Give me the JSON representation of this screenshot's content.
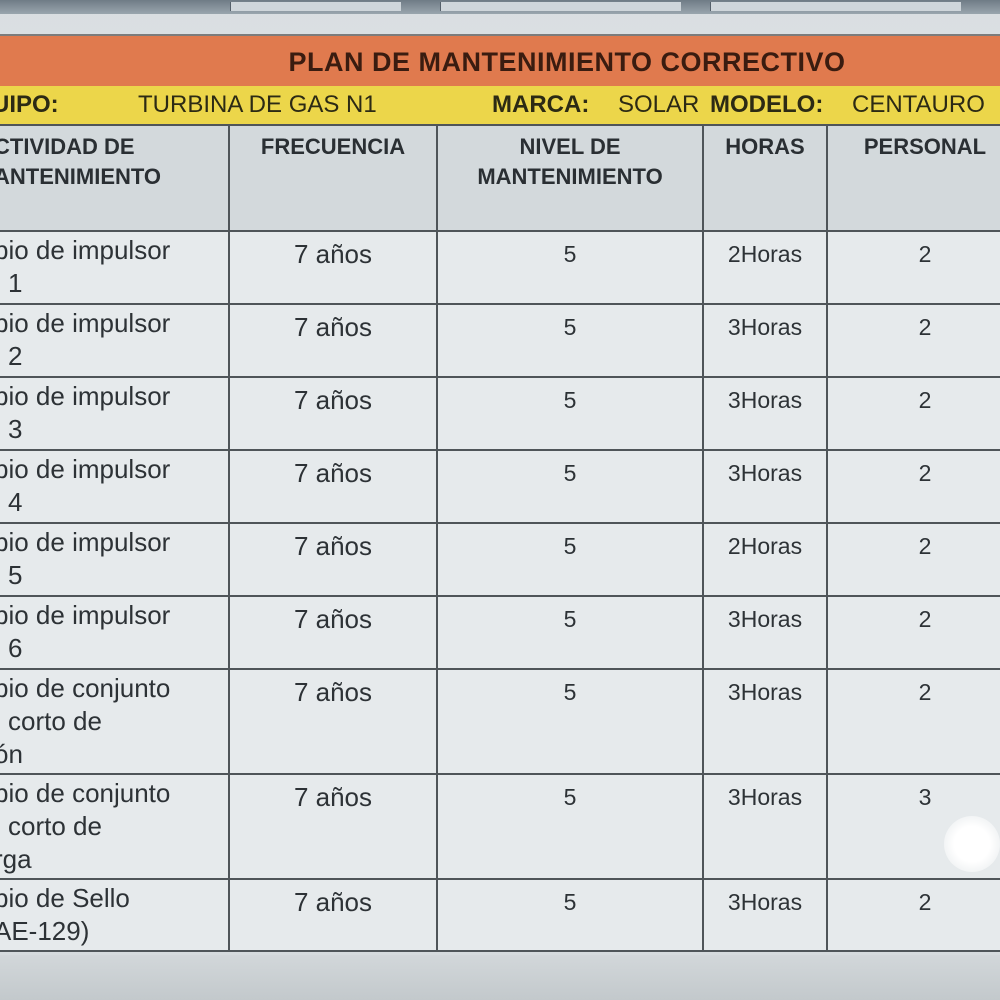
{
  "sheet": {
    "title": "PLAN DE MANTENIMIENTO CORRECTIVO",
    "info": {
      "equipo_label": "UIPO:",
      "equipo_value": "TURBINA DE GAS   N1",
      "marca_label": "MARCA:",
      "marca_value": "SOLAR",
      "modelo_label": "MODELO:",
      "modelo_value": "CENTAURO"
    },
    "headers": {
      "actividad_line1": "CTIVIDAD DE",
      "actividad_line2": "ANTENIMIENTO",
      "frecuencia": "FRECUENCIA",
      "nivel_line1": "NIVEL DE",
      "nivel_line2": "MANTENIMIENTO",
      "horas": "HORAS",
      "personal": "PERSONAL"
    },
    "rows": [
      {
        "act1": "bio de impulsor",
        "act2": "1",
        "act3": "",
        "frecuencia": "7 años",
        "nivel": "5",
        "horas": "2Horas",
        "personal": "2"
      },
      {
        "act1": "bio de impulsor",
        "act2": "2",
        "act3": "",
        "frecuencia": "7 años",
        "nivel": "5",
        "horas": "3Horas",
        "personal": "2"
      },
      {
        "act1": "bio de impulsor",
        "act2": "3",
        "act3": "",
        "frecuencia": "7 años",
        "nivel": "5",
        "horas": "3Horas",
        "personal": "2"
      },
      {
        "act1": "bio de impulsor",
        "act2": "4",
        "act3": "",
        "frecuencia": "7 años",
        "nivel": "5",
        "horas": "3Horas",
        "personal": "2"
      },
      {
        "act1": "bio de impulsor",
        "act2": "5",
        "act3": "",
        "frecuencia": "7 años",
        "nivel": "5",
        "horas": "2Horas",
        "personal": "2"
      },
      {
        "act1": "bio de impulsor",
        "act2": "6",
        "act3": "",
        "frecuencia": "7 años",
        "nivel": "5",
        "horas": "3Horas",
        "personal": "2"
      },
      {
        "act1": "bio de conjunto",
        "act2": "corto de",
        "act3": "ón",
        "frecuencia": "7 años",
        "nivel": "5",
        "horas": "3Horas",
        "personal": "2"
      },
      {
        "act1": "bio de conjunto",
        "act2": "corto de",
        "act3": "rga",
        "frecuencia": "7 años",
        "nivel": "5",
        "horas": "3Horas",
        "personal": "3"
      },
      {
        "act1": "bio de Sello",
        "act2": "AE-129)",
        "act3": "",
        "frecuencia": "7 años",
        "nivel": "5",
        "horas": "3Horas",
        "personal": "2"
      }
    ]
  },
  "colors": {
    "title_band": "#e07a4e",
    "info_band": "#ecd64a",
    "grid_line": "#4f5559",
    "cell_bg": "#e6eaec"
  }
}
